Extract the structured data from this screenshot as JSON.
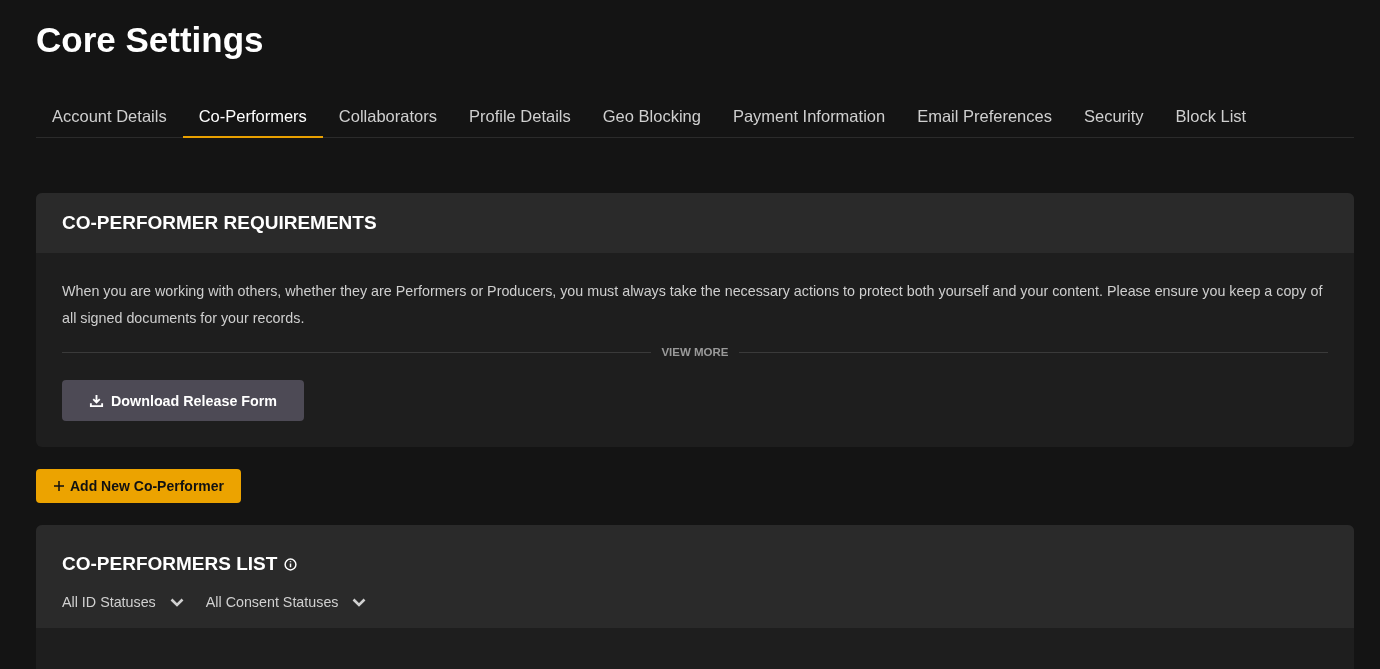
{
  "title": "Core Settings",
  "tabs": [
    {
      "label": "Account Details",
      "selected": false
    },
    {
      "label": "Co-Performers",
      "selected": true
    },
    {
      "label": "Collaborators",
      "selected": false
    },
    {
      "label": "Profile Details",
      "selected": false
    },
    {
      "label": "Geo Blocking",
      "selected": false
    },
    {
      "label": "Payment Information",
      "selected": false
    },
    {
      "label": "Email Preferences",
      "selected": false
    },
    {
      "label": "Security",
      "selected": false
    },
    {
      "label": "Block List",
      "selected": false
    }
  ],
  "requirements": {
    "heading": "CO-PERFORMER REQUIREMENTS",
    "text": "When you are working with others, whether they are Performers or Producers, you must always take the necessary actions to protect both yourself and your content. Please ensure you keep a copy of all signed documents for your records.",
    "view_more": "VIEW MORE",
    "download_button": "Download Release Form"
  },
  "add_button": "Add New Co-Performer",
  "list": {
    "heading": "CO-PERFORMERS LIST",
    "filters": [
      {
        "label": "All ID Statuses"
      },
      {
        "label": "All Consent Statuses"
      }
    ]
  }
}
